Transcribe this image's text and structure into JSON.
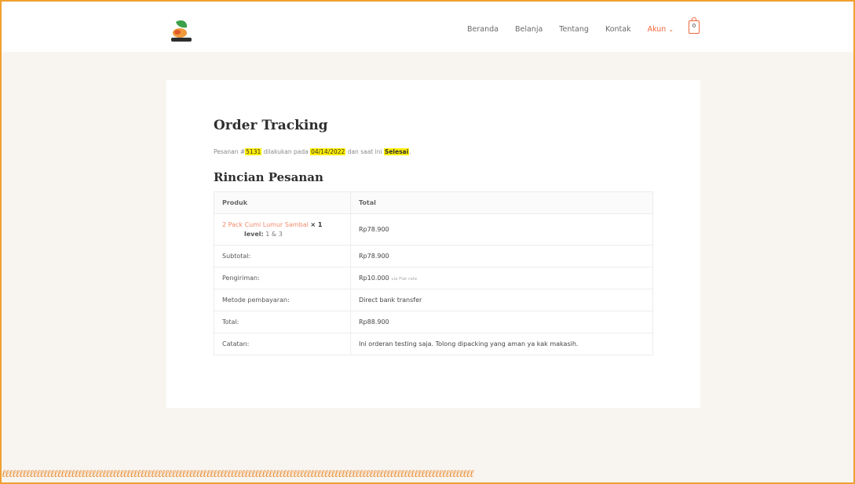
{
  "nav": {
    "items": [
      "Beranda",
      "Belanja",
      "Tentang",
      "Kontak"
    ],
    "account": "Akun",
    "cart_count": "0"
  },
  "page": {
    "title": "Order Tracking",
    "notice": {
      "prefix": "Pesanan #",
      "order_number": "5131",
      "mid1": " dilakukan pada ",
      "date": "04/14/2022",
      "mid2": " dan saat ini ",
      "status": "Selesai",
      "suffix": "."
    },
    "details_title": "Rincian Pesanan"
  },
  "table": {
    "head": {
      "product": "Produk",
      "total": "Total"
    },
    "item": {
      "name": "2 Pack Cumi Lumur Sambal",
      "qty": "× 1",
      "meta_key": "level:",
      "meta_value": "1 & 3",
      "total": "Rp78.900"
    },
    "rows": [
      {
        "label": "Subtotal:",
        "value": "Rp78.900",
        "note": ""
      },
      {
        "label": "Pengiriman:",
        "value": "Rp10.000",
        "note": "via Flat rate"
      },
      {
        "label": "Metode pembayaran:",
        "value": "Direct bank transfer",
        "note": ""
      },
      {
        "label": "Total:",
        "value": "Rp88.900",
        "note": ""
      },
      {
        "label": "Catatan:",
        "value": "Ini orderan testing saja. Tolong dipacking yang aman ya kak makasih.",
        "note": ""
      }
    ]
  },
  "colors": {
    "accent": "#f0673c",
    "highlight": "#ffee00",
    "frame": "#f0a030"
  },
  "footer": {
    "wave": "ℓℓℓℓℓℓℓℓℓℓℓℓℓℓℓℓℓℓℓℓℓℓℓℓℓℓℓℓℓℓℓℓℓℓℓℓℓℓℓℓℓℓℓℓℓℓℓℓℓℓℓℓℓℓℓℓℓℓℓℓℓℓℓℓℓℓℓℓℓℓℓℓℓℓℓℓℓℓℓℓℓℓℓℓℓℓℓℓℓℓℓℓℓℓℓℓℓℓℓℓℓℓℓℓℓℓℓℓℓℓℓℓℓℓℓℓℓℓℓℓℓℓℓℓℓℓℓℓℓℓℓℓℓℓℓℓ"
  }
}
